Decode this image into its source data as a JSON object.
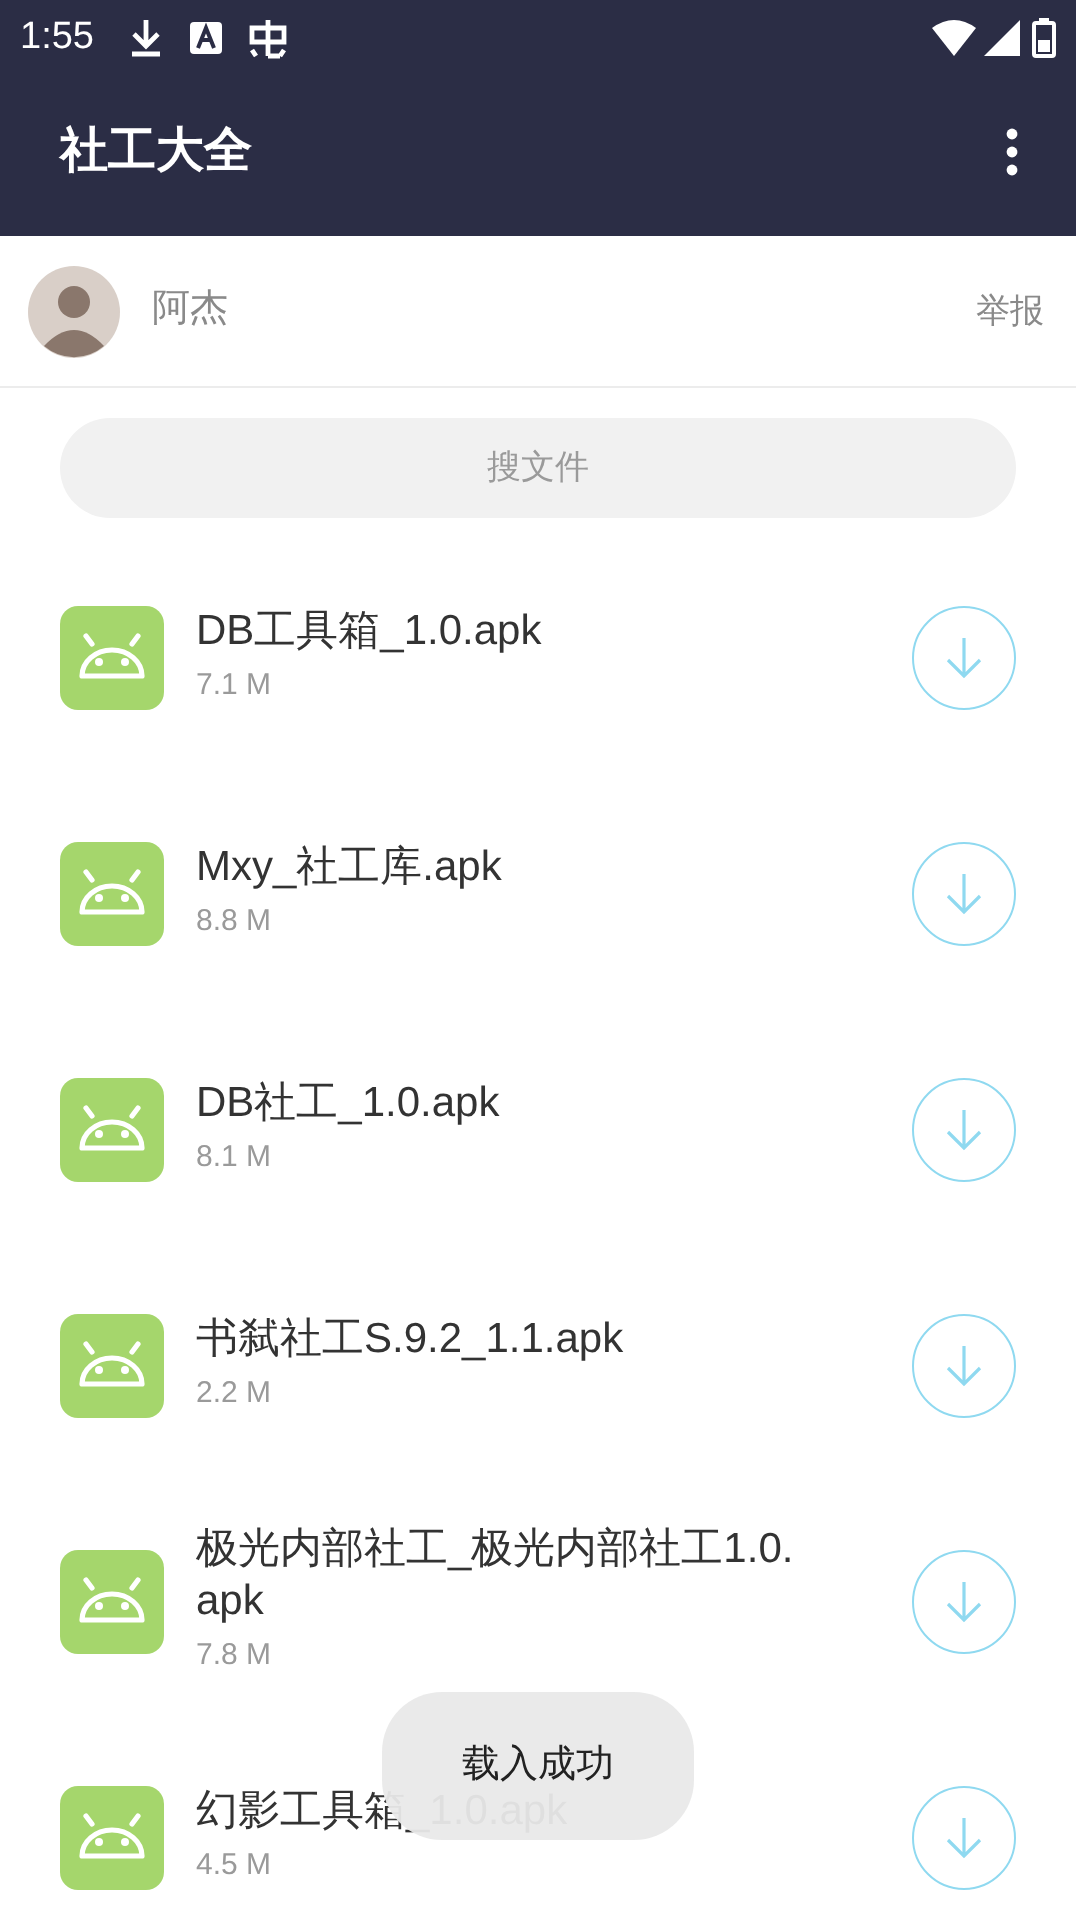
{
  "status_bar": {
    "time": "1:55"
  },
  "app_bar": {
    "title": "社工大全"
  },
  "user": {
    "name": "阿杰",
    "report": "举报"
  },
  "search": {
    "placeholder": "搜文件"
  },
  "files": [
    {
      "name": "DB工具箱_1.0.apk",
      "size": "7.1 M"
    },
    {
      "name": "Mxy_社工库.apk",
      "size": "8.8 M"
    },
    {
      "name": "DB社工_1.0.apk",
      "size": "8.1 M"
    },
    {
      "name": "书弑社工S.9.2_1.1.apk",
      "size": "2.2 M"
    },
    {
      "name": "极光内部社工_极光内部社工1.0.apk",
      "size": "7.8 M"
    },
    {
      "name": "幻影工具箱_1.0.apk",
      "size": "4.5 M"
    }
  ],
  "toast": "载入成功"
}
